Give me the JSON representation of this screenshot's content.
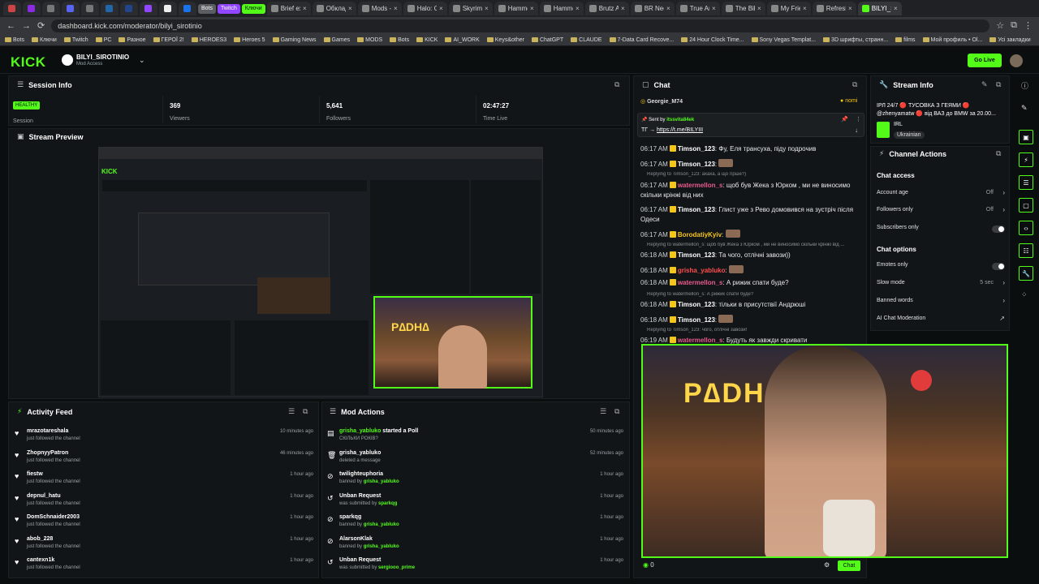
{
  "browser": {
    "tabs": [
      {
        "label": "",
        "color": "#c44"
      },
      {
        "label": "",
        "color": "#8a2be2"
      },
      {
        "label": "",
        "color": "#777"
      },
      {
        "label": "",
        "color": "#5865f2"
      },
      {
        "label": "",
        "color": "#777"
      },
      {
        "label": "",
        "color": "#2266aa"
      },
      {
        "label": "",
        "color": "#224488"
      },
      {
        "label": "",
        "color": "#9146ff"
      },
      {
        "label": "",
        "color": "#eee"
      },
      {
        "label": "",
        "color": "#1a73e8"
      }
    ],
    "pill_tabs": [
      "Bots",
      "Twitch",
      "Ключи"
    ],
    "named_tabs": [
      "Brief explan",
      "Обкладинк",
      "Mods - Nex",
      "Halo: Camp",
      "Skyrim Spe",
      "Hammet Du",
      "Hammet's S",
      "Brutz Armo",
      "BR Needle c",
      "True Arctic S",
      "The Bike In",
      "My Friend Jo",
      "Refreshing",
      "BILYI_SI"
    ],
    "url": "dashboard.kick.com/moderator/bilyi_sirotinio",
    "bookmarks": [
      "Bots",
      "Ключи",
      "Twitch",
      "PC",
      "Разное",
      "ГЕРОЇ 2!",
      "HEROES3",
      "Heroes 5",
      "Gaming News",
      "Games",
      "MODS",
      "Bots",
      "KICK",
      "AI_WORK",
      "Keys&other",
      "ChatGPT",
      "CLAUDE",
      "7-Data Card Recove...",
      "24 Hour Clock Time...",
      "Sony Vegas Templat...",
      "3D шрифты, странн...",
      "films",
      "Мой профиль • Ol...",
      "Усі закладки"
    ]
  },
  "header": {
    "logo": "KICK",
    "channel_name": "BILYI_SIROTINIO",
    "role": "Mod Access",
    "go_live": "Go Live"
  },
  "session": {
    "title": "Session Info",
    "status": "HEALTHY",
    "status_label": "Session",
    "viewers": "369",
    "viewers_label": "Viewers",
    "followers": "5,641",
    "followers_label": "Followers",
    "time_live": "02:47:27",
    "time_live_label": "Time Live"
  },
  "preview": {
    "title": "Stream Preview"
  },
  "activity": {
    "title": "Activity Feed",
    "items": [
      {
        "name": "mrazotareshala",
        "sub": "just followed the channel",
        "time": "10 minutes ago"
      },
      {
        "name": "ZhopnyyPatron",
        "sub": "just followed the channel",
        "time": "46 minutes ago"
      },
      {
        "name": "fiestw",
        "sub": "just followed the channel",
        "time": "1 hour ago"
      },
      {
        "name": "depnul_hatu",
        "sub": "just followed the channel",
        "time": "1 hour ago"
      },
      {
        "name": "DomSchnaider2003",
        "sub": "just followed the channel",
        "time": "1 hour ago"
      },
      {
        "name": "abob_228",
        "sub": "just followed the channel",
        "time": "1 hour ago"
      },
      {
        "name": "cantexn1k",
        "sub": "just followed the channel",
        "time": "1 hour ago"
      }
    ]
  },
  "mod_actions": {
    "title": "Mod Actions",
    "items": [
      {
        "name": "grisha_yabluko",
        "verb": " started a Poll",
        "sub": "СКІЛЬКИ РОКІВ?",
        "by": "",
        "time": "50 minutes ago",
        "icon": "poll-icon",
        "green_name": true
      },
      {
        "name": "grisha_yabluko",
        "verb": "",
        "sub": "deleted a message",
        "by": "",
        "time": "52 minutes ago",
        "icon": "trash-icon",
        "green_name": false
      },
      {
        "name": "twilighteuphoria",
        "verb": "",
        "sub": "banned by ",
        "by": "grisha_yabluko",
        "time": "1 hour ago",
        "icon": "ban-icon",
        "green_name": false
      },
      {
        "name": "Unban Request",
        "verb": "",
        "sub": "was submitted by ",
        "by": "sparkqg",
        "time": "1 hour ago",
        "icon": "unban-request-icon",
        "green_name": false
      },
      {
        "name": "sparkqg",
        "verb": "",
        "sub": "banned by ",
        "by": "grisha_yabluko",
        "time": "1 hour ago",
        "icon": "ban-icon",
        "green_name": false
      },
      {
        "name": "AlarsonKlak",
        "verb": "",
        "sub": "banned by ",
        "by": "grisha_yabluko",
        "time": "1 hour ago",
        "icon": "ban-icon",
        "green_name": false
      },
      {
        "name": "Unban Request",
        "verb": "",
        "sub": "was submitted by ",
        "by": "sergiooo_prime",
        "time": "1 hour ago",
        "icon": "unban-request-icon",
        "green_name": false
      }
    ]
  },
  "chat": {
    "title": "Chat",
    "top_user": "Georgie_M74",
    "top_right": "nomi",
    "pinned_by_label": "Sent by",
    "pinned_by": "itssvita84ek",
    "pinned_text_prefix": "ТГ → ",
    "pinned_link": "https://t.me/BILYIII",
    "messages": [
      {
        "time": "06:17 AM",
        "user": "Timson_123",
        "color": "#ffffff",
        "text": "Фу, Еля трансуха, піду подрочив"
      },
      {
        "time": "06:17 AM",
        "user": "Timson_123",
        "color": "#ffffff",
        "text": ""
      },
      {
        "reply": "Replying to Timson_123: ахаха, а що гірше?)"
      },
      {
        "time": "06:17 AM",
        "user": "watermellon_s",
        "color": "#e85b8a",
        "text": "щоб був Жека з Юрком , ми не виносимо скільки крінжі від них"
      },
      {
        "time": "06:17 AM",
        "user": "Timson_123",
        "color": "#ffffff",
        "text": "Глист уже з Рево домовився на зустріч після Одеси"
      },
      {
        "time": "06:17 AM",
        "user": "BorodatiyKyiv",
        "color": "#f5c518",
        "text": ""
      },
      {
        "reply": "Replying to watermellon_s: щоб був Жека з Юрком , ми не виносимо скільки крінжі від ..."
      },
      {
        "time": "06:18 AM",
        "user": "Timson_123",
        "color": "#ffffff",
        "text": "Та чого, отлічні завози))"
      },
      {
        "time": "06:18 AM",
        "user": "grisha_yabluko",
        "color": "#ff4d4d",
        "text": ""
      },
      {
        "time": "06:18 AM",
        "user": "watermellon_s",
        "color": "#e85b8a",
        "text": "А рижик спати буде?"
      },
      {
        "reply": "Replying to watermellon_s: А рижик спати буде?"
      },
      {
        "time": "06:18 AM",
        "user": "Timson_123",
        "color": "#ffffff",
        "text": "тільки в присутствії Андрюші"
      },
      {
        "time": "06:18 AM",
        "user": "Timson_123",
        "color": "#ffffff",
        "text": ""
      },
      {
        "reply": "Replying to Timson_123: чого, отлічні завози!"
      },
      {
        "time": "06:19 AM",
        "user": "watermellon_s",
        "color": "#e85b8a",
        "text": "Будуть як завжди скривати"
      }
    ],
    "viewers_count": "0",
    "chat_button": "Chat"
  },
  "stream_info": {
    "title": "Stream Info",
    "stream_title": "ІРЛ 24/7 🔴 ТУСОВКА З ГЕЯМИ 🔴 @zhenyamatw 🔴 від ВАЗ до BMW за 20.00...",
    "category": "IRL",
    "language": "Ukrainian"
  },
  "channel_actions": {
    "title": "Channel Actions",
    "chat_access": "Chat access",
    "account_age": "Account age",
    "account_age_val": "Off",
    "followers_only": "Followers only",
    "followers_only_val": "Off",
    "subscribers_only": "Subscribers only",
    "chat_options": "Chat options",
    "emotes_only": "Emotes only",
    "slow_mode": "Slow mode",
    "slow_mode_val": "5 sec",
    "banned_words": "Banned words",
    "ai_moderation": "AI Chat Moderation"
  },
  "colors": {
    "accent": "#53fc18",
    "bg": "#0b0e0f",
    "panel": "#121518"
  }
}
